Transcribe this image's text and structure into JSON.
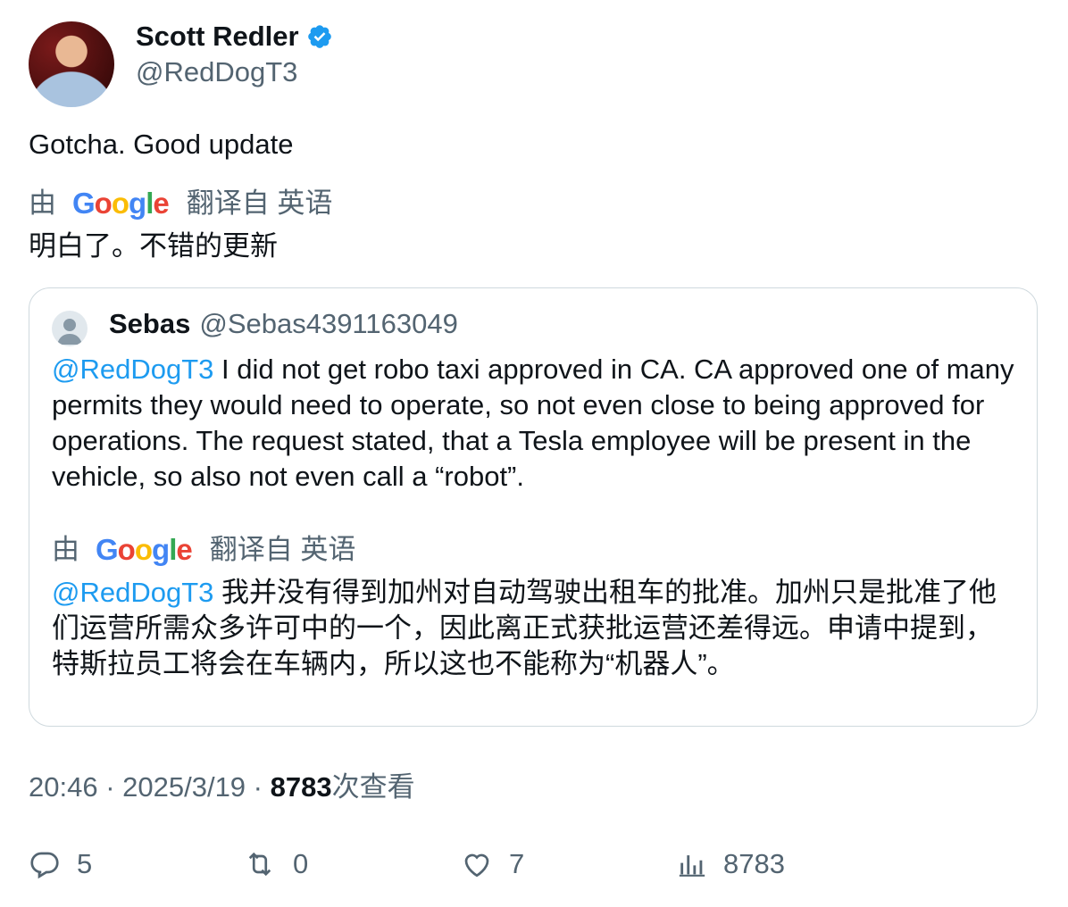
{
  "tweet": {
    "author_name": "Scott Redler",
    "author_handle": "@RedDogT3",
    "text": "Gotcha. Good update",
    "translation": {
      "by_label": "由",
      "provider": "Google",
      "from_label": "翻译自 英语",
      "text": "明白了。不错的更新"
    }
  },
  "quoted": {
    "author_name": "Sebas",
    "author_handle": "@Sebas4391163049",
    "mention": "@RedDogT3",
    "text": " I did not get robo taxi approved in CA. CA approved one of many permits they would need to operate, so not even close to being approved for operations. The request stated, that a Tesla employee will be present in the vehicle, so also not even call a “robot”.",
    "translation": {
      "by_label": "由",
      "provider": "Google",
      "from_label": "翻译自 英语",
      "mention": "@RedDogT3",
      "text": " 我并没有得到加州对自动驾驶出租车的批准。加州只是批准了他们运营所需众多许可中的一个，因此离正式获批运营还差得远。申请中提到，特斯拉员工将会在车辆内，所以这也不能称为“机器人”。"
    }
  },
  "meta": {
    "time": "20:46",
    "sep1": " · ",
    "date": "2025/3/19",
    "sep2": " · ",
    "views_count": "8783",
    "views_label": "次查看"
  },
  "actions": {
    "replies": "5",
    "retweets": "0",
    "likes": "7",
    "views": "8783"
  },
  "colors": {
    "link": "#1d9bf0",
    "muted": "#536471",
    "verified": "#1d9bf0"
  },
  "icons": [
    "verified-badge-icon",
    "reply-icon",
    "retweet-icon",
    "like-icon",
    "views-icon",
    "google-logo"
  ]
}
